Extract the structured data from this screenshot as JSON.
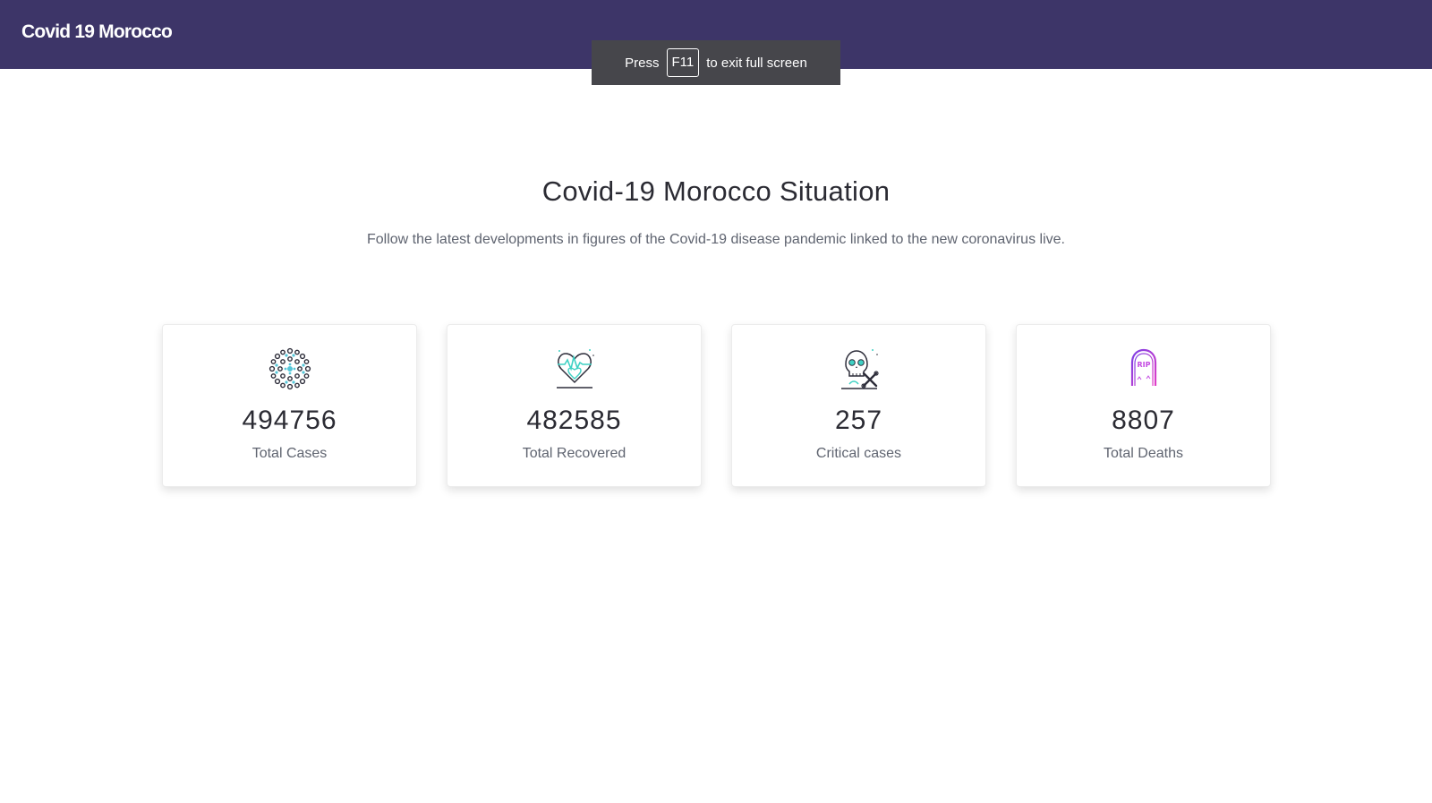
{
  "navbar": {
    "brand": "Covid 19 Morocco"
  },
  "fullscreen_notice": {
    "prefix": "Press",
    "key": "F11",
    "suffix": "to exit full screen"
  },
  "hero": {
    "title": "Covid-19 Morocco Situation",
    "subtitle": "Follow the latest developments in figures of the Covid-19 disease pandemic linked to the new coronavirus live."
  },
  "stats": [
    {
      "icon": "virus-icon",
      "value": "494756",
      "label": "Total Cases"
    },
    {
      "icon": "recovered-heart-icon",
      "value": "482585",
      "label": "Total Recovered"
    },
    {
      "icon": "skull-crossbones-icon",
      "value": "257",
      "label": "Critical cases"
    },
    {
      "icon": "rip-tombstone-icon",
      "value": "8807",
      "label": "Total Deaths"
    }
  ],
  "colors": {
    "navbar_bg": "#3d3568",
    "virus_accent": "#57c7d9",
    "recovered_accent": "#3fd1c4",
    "deaths_accent": "#c44be2"
  }
}
